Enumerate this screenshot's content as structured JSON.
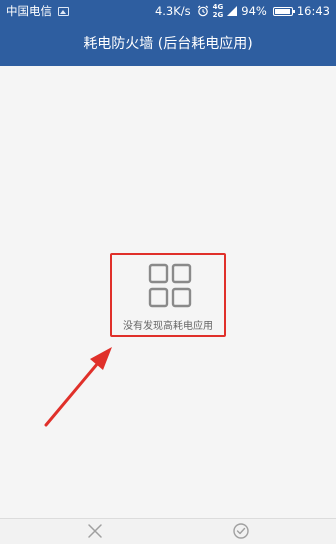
{
  "status_bar": {
    "carrier": "中国电信",
    "net_speed": "4.3K/s",
    "network_top": "4G",
    "network_bottom": "2G",
    "battery_percent": "94%",
    "battery_level": 0.94,
    "time": "16:43"
  },
  "header": {
    "title": "耗电防火墙 (后台耗电应用)"
  },
  "main": {
    "empty_icon": "grid-icon",
    "empty_message": "没有发现高耗电应用"
  },
  "annotation": {
    "color": "#e0302a"
  },
  "bottom_bar": {
    "cancel_icon": "close-icon",
    "confirm_icon": "check-circle-icon"
  },
  "colors": {
    "accent": "#2e5ea0",
    "annotation": "#e0302a",
    "icon_gray": "#8a8a8a"
  }
}
